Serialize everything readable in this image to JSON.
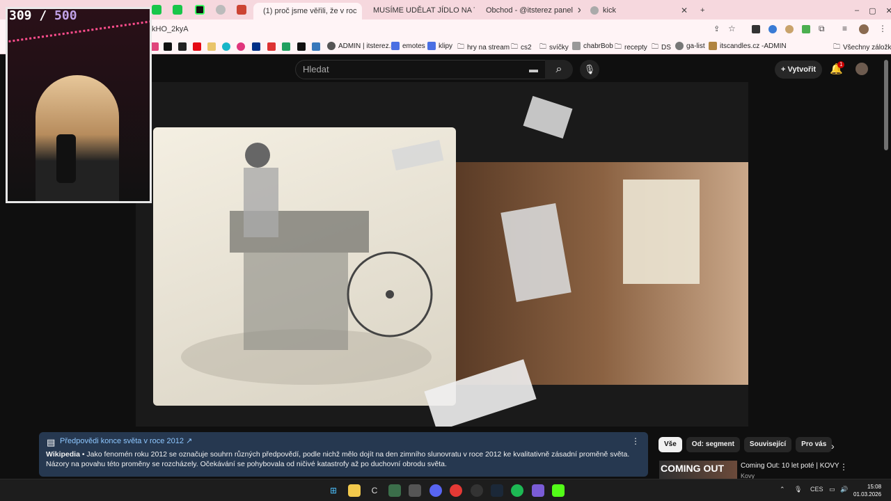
{
  "browser": {
    "tabs": [
      {
        "title": "(1) proč jsme věřili, že v roc"
      },
      {
        "title": "MUSÍME UDĚLAT JÍDLO NA TÝD"
      },
      {
        "title": "Obchod - @itsterez panel"
      },
      {
        "title": "kick"
      }
    ],
    "new_tab": "+",
    "address": "kHO_2kyA",
    "bookmarks": [
      "ADMIN | itsterez.cz",
      "emotes",
      "klipy",
      "hry na stream",
      "cs2",
      "svíčky",
      "chabrBob",
      "recepty",
      "DS",
      "ga-list",
      "itscandles.cz -ADMIN",
      "Všechny záložky"
    ]
  },
  "youtube": {
    "search_placeholder": "Hledat",
    "create_label": "Vytvořit",
    "notif_count": "1"
  },
  "overlay": {
    "count": "309",
    "separator": " / ",
    "goal": "500"
  },
  "info_panel": {
    "title": "Předpovědi konce světa v roce 2012 ↗",
    "source": "Wikipedia",
    "text": " • Jako fenomén roku 2012 se označuje souhrn různých předpovědí, podle nichž mělo dojít na den zimního slunovratu v roce 2012 ke kvalitativně zásadní proměně světa. Názory na povahu této proměny se rozcházely. Očekávání se pohybovala od ničivé katastrofy až po duchovní obrodu světa."
  },
  "chips": [
    "Vše",
    "Od: segment",
    "Související",
    "Pro vás"
  ],
  "recommendation": {
    "thumb_text": "COMING OUT",
    "title": "Coming Out: 10 let poté | KOVY",
    "channel": "Kovy"
  },
  "system": {
    "lang": "CES",
    "time": "15:08",
    "date": "01.03.2026"
  }
}
